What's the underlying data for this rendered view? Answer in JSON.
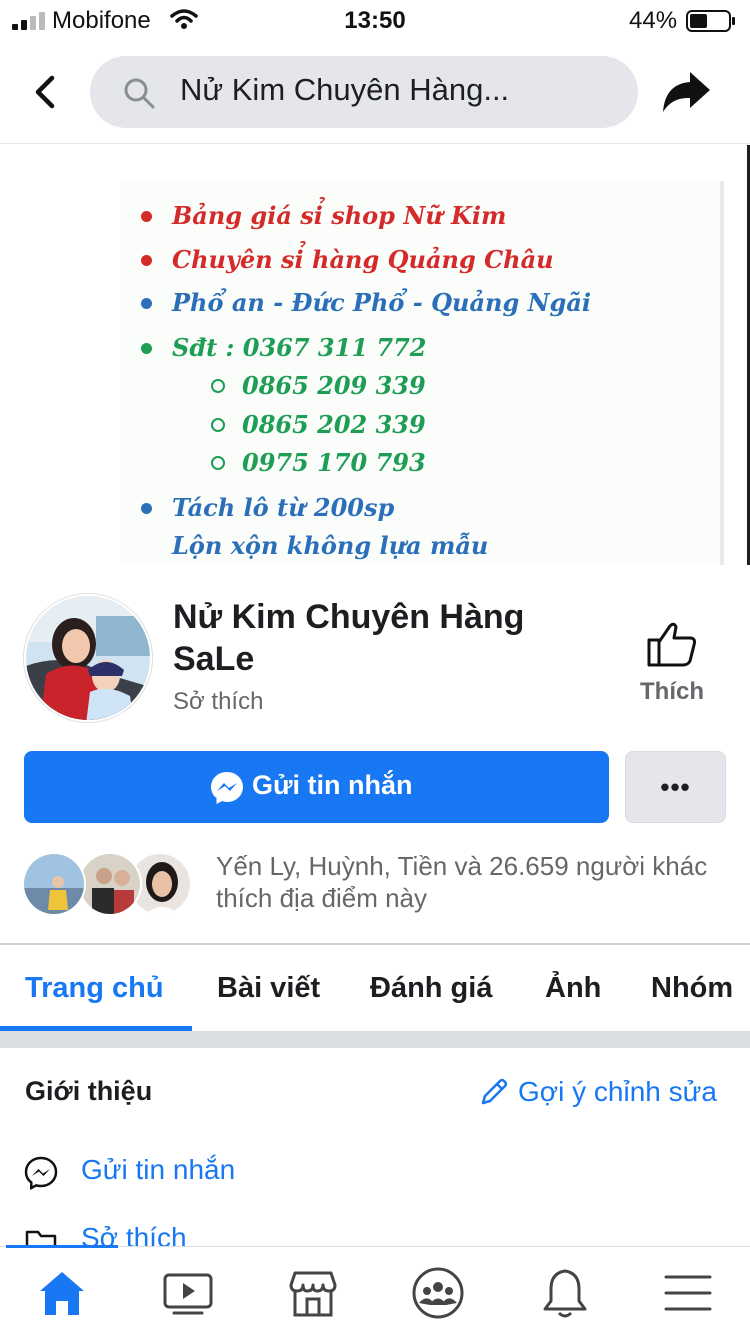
{
  "status_bar": {
    "carrier": "Mobifone",
    "time": "13:50",
    "battery": "44%"
  },
  "header": {
    "search_text": "Nử Kim Chuyên Hàng..."
  },
  "cover": {
    "lines": [
      {
        "text": "Bảng giá sỉ shop Nữ Kim",
        "color": "#d42a2a",
        "bullet": "dot"
      },
      {
        "text": "Chuyên sỉ hàng Quảng Châu",
        "color": "#d42a2a",
        "bullet": "dot"
      },
      {
        "text": "Phổ an - Đức Phổ - Quảng Ngãi",
        "color": "#2a6fb8",
        "bullet": "dot"
      },
      {
        "text": "Sđt : 0367 311 772",
        "color": "#1e9d55",
        "bullet": "dot"
      },
      {
        "text": "0865 209 339",
        "color": "#1e9d55",
        "bullet": "ring"
      },
      {
        "text": "0865 202 339",
        "color": "#1e9d55",
        "bullet": "ring"
      },
      {
        "text": "0975 170 793",
        "color": "#1e9d55",
        "bullet": "ring"
      },
      {
        "text": "Tách lô từ 200sp",
        "color": "#2a6fb8",
        "bullet": "dot"
      },
      {
        "text": "Lộn xộn không lựa mẫu",
        "color": "#2a6fb8",
        "bullet": "none"
      }
    ]
  },
  "profile": {
    "name": "Nử Kim Chuyên Hàng SaLe",
    "category": "Sở thích",
    "like_label": "Thích"
  },
  "actions": {
    "message_label": "Gửi tin nhắn",
    "more_label": "•••"
  },
  "likers": {
    "text": "Yến Ly, Huỳnh, Tiền và 26.659 người khác thích địa điểm này"
  },
  "tabs": [
    {
      "label": "Trang chủ",
      "active": true
    },
    {
      "label": "Bài viết",
      "active": false
    },
    {
      "label": "Đánh giá",
      "active": false
    },
    {
      "label": "Ảnh",
      "active": false
    },
    {
      "label": "Nhóm",
      "active": false
    }
  ],
  "intro": {
    "title": "Giới thiệu",
    "suggest_edit": "Gợi ý chỉnh sửa",
    "rows": [
      {
        "icon": "messenger-icon",
        "label": "Gửi tin nhắn"
      },
      {
        "icon": "category-icon",
        "label": "Sở thích"
      }
    ]
  },
  "bottom_nav": [
    {
      "icon": "home-icon",
      "active": true
    },
    {
      "icon": "watch-icon",
      "active": false
    },
    {
      "icon": "marketplace-icon",
      "active": false
    },
    {
      "icon": "groups-icon",
      "active": false
    },
    {
      "icon": "notifications-icon",
      "active": false
    },
    {
      "icon": "menu-icon",
      "active": false
    }
  ],
  "colors": {
    "accent": "#1877f2",
    "secondary_text": "#65676b",
    "button_gray": "#e4e6eb"
  }
}
